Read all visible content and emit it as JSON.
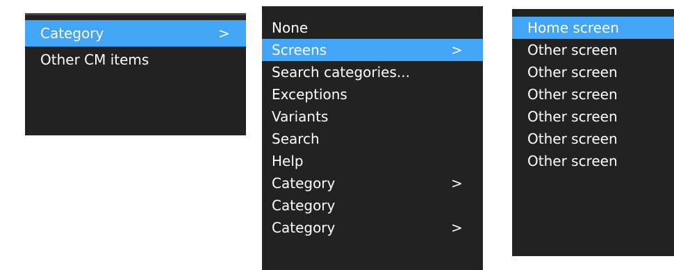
{
  "colors": {
    "panel_bg": "#222222",
    "selected_bg": "#42a5f5",
    "text": "#ffffff"
  },
  "menu1": {
    "items": [
      {
        "label": "Category",
        "chevron": ">",
        "selected": true
      },
      {
        "label": "Other CM items",
        "chevron": "",
        "selected": false
      }
    ]
  },
  "menu2": {
    "items": [
      {
        "label": "None",
        "chevron": "",
        "selected": false
      },
      {
        "label": "Screens",
        "chevron": ">",
        "selected": true
      },
      {
        "label": "Search categories...",
        "chevron": "",
        "selected": false
      },
      {
        "label": "Exceptions",
        "chevron": "",
        "selected": false
      },
      {
        "label": "Variants",
        "chevron": "",
        "selected": false
      },
      {
        "label": "Search",
        "chevron": "",
        "selected": false
      },
      {
        "label": "Help",
        "chevron": "",
        "selected": false
      },
      {
        "label": "Category",
        "chevron": ">",
        "selected": false
      },
      {
        "label": "Category",
        "chevron": "",
        "selected": false
      },
      {
        "label": "Category",
        "chevron": ">",
        "selected": false
      }
    ]
  },
  "menu3": {
    "items": [
      {
        "label": "Home screen",
        "selected": true
      },
      {
        "label": "Other screen",
        "selected": false
      },
      {
        "label": "Other screen",
        "selected": false
      },
      {
        "label": "Other screen",
        "selected": false
      },
      {
        "label": "Other screen",
        "selected": false
      },
      {
        "label": "Other screen",
        "selected": false
      },
      {
        "label": "Other screen",
        "selected": false
      }
    ]
  }
}
